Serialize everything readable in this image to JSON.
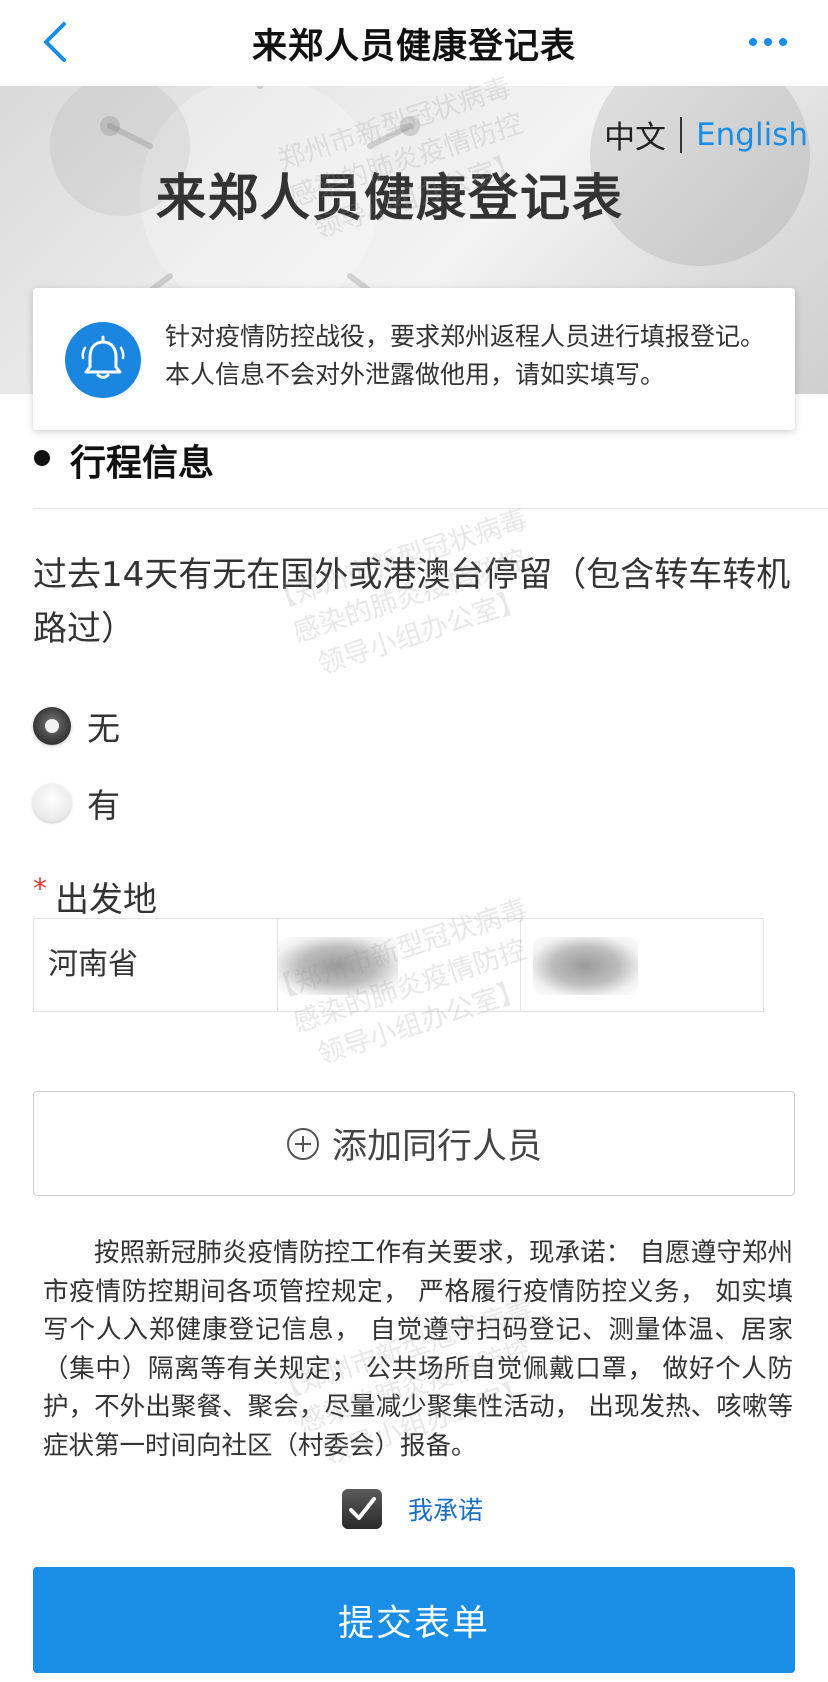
{
  "nav": {
    "title": "来郑人员健康登记表",
    "back_icon": "chevron-left-icon",
    "more_icon": "more-dots-icon"
  },
  "hero": {
    "lang_zh": "中文",
    "lang_en": "English",
    "title": "来郑人员健康登记表"
  },
  "notice": {
    "icon": "bell-icon",
    "text": "针对疫情防控战役，要求郑州返程人员进行填报登记。本人信息不会对外泄露做他用，请如实填写。"
  },
  "section": {
    "title": "行程信息"
  },
  "question": {
    "text": "过去14天有无在国外或港澳台停留（包含转车转机路过）",
    "options": [
      {
        "label": "无",
        "checked": true
      },
      {
        "label": "有",
        "checked": false
      }
    ]
  },
  "departure": {
    "required_mark": "*",
    "label": "出发地",
    "province": "河南省"
  },
  "add_companion": {
    "icon": "plus-circle-icon",
    "label": "添加同行人员"
  },
  "promise": {
    "text": "按照新冠肺炎疫情防控工作有关要求，现承诺： 自愿遵守郑州市疫情防控期间各项管控规定， 严格履行疫情防控义务， 如实填写个人入郑健康登记信息， 自觉遵守扫码登记、测量体温、居家（集中）隔离等有关规定； 公共场所自觉佩戴口罩， 做好个人防护，不外出聚餐、聚会，尽量减少聚集性活动， 出现发热、咳嗽等症状第一时间向社区（村委会）报备。"
  },
  "agree": {
    "label": "我承诺",
    "checked": true
  },
  "submit": {
    "label": "提交表单"
  },
  "watermark": {
    "line1": "郑州市新型冠状病毒",
    "line2": "【郑州市新型冠状病毒",
    "line3": "感染的肺炎疫情防控",
    "line4": "领导小组办公室】"
  },
  "colors": {
    "accent": "#1a8ee6",
    "required": "#e53935",
    "link": "#1a6fc4"
  }
}
